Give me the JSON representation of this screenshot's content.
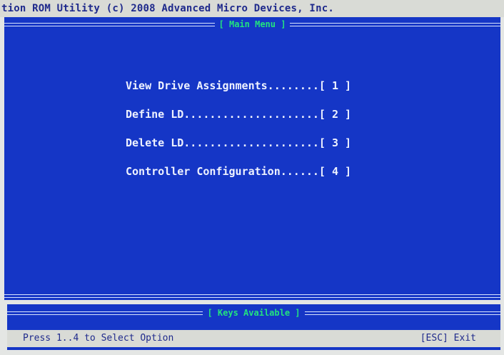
{
  "title": "tion ROM Utility (c) 2008 Advanced Micro Devices, Inc.",
  "main_menu": {
    "caption": "[ Main Menu ]",
    "items": [
      {
        "label": "View Drive Assignments........[ 1 ]"
      },
      {
        "label": "Define LD.....................[ 2 ]"
      },
      {
        "label": "Delete LD.....................[ 3 ]"
      },
      {
        "label": "Controller Configuration......[ 4 ]"
      }
    ]
  },
  "keys_panel": {
    "caption": "[ Keys Available ]"
  },
  "status": {
    "hint": "Press 1..4 to Select Option",
    "exit": "[ESC] Exit"
  },
  "colors": {
    "panel_blue": "#1536c6",
    "caption_green": "#23e27f",
    "bar_grey": "#d9dbd6",
    "text_navy": "#1f2a8c"
  }
}
